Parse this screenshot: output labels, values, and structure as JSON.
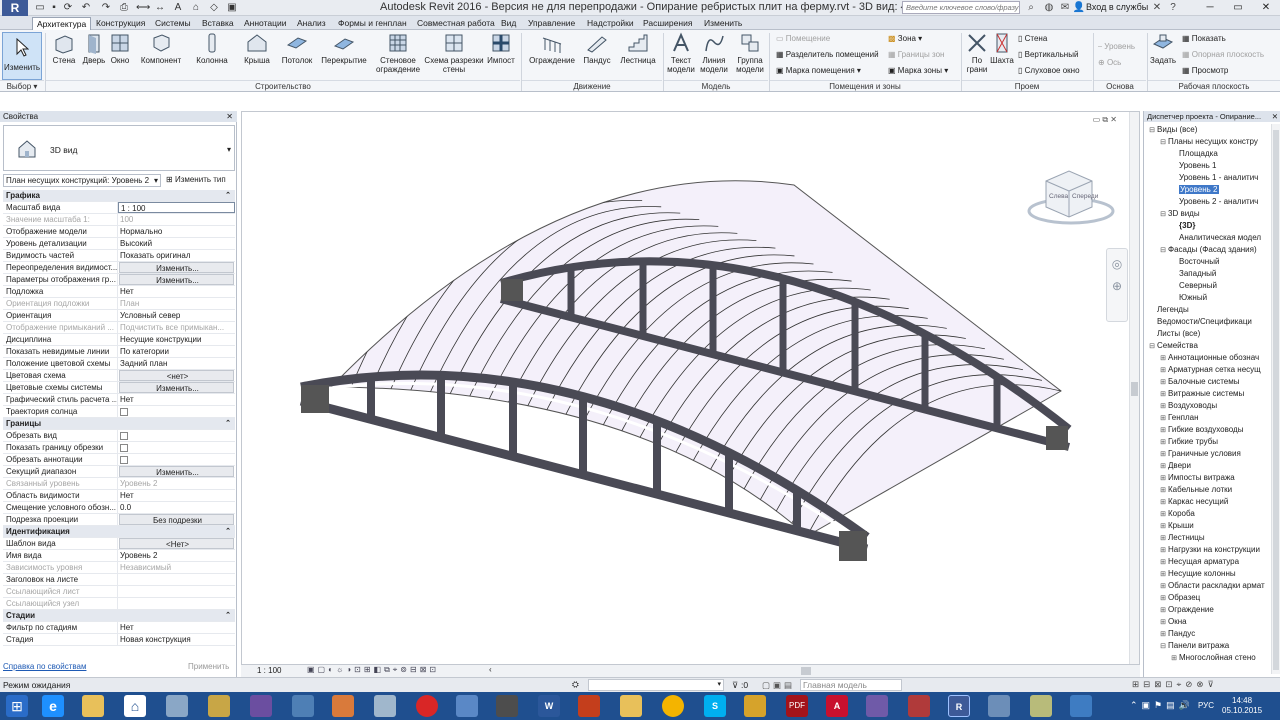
{
  "titlebar": {
    "app_logo": "R",
    "title": "Autodesk Revit 2016 - Версия не для перепродажи -    Опирание ребристых плит на ферму.rvt - 3D вид: {3D}",
    "search_placeholder": "Введите ключевое слово/фразу",
    "signin": "Вход в службы"
  },
  "tabs": [
    "Архитектура",
    "Конструкция",
    "Системы",
    "Вставка",
    "Аннотации",
    "Анализ",
    "Формы и генплан",
    "Совместная работа",
    "Вид",
    "Управление",
    "Надстройки",
    "Расширения",
    "Изменить"
  ],
  "ribbon": {
    "modify": "Изменить",
    "select": "Выбор",
    "build": {
      "label": "Строительство",
      "buttons": [
        "Стена",
        "Дверь",
        "Окно",
        "Компонент",
        "Колонна",
        "Крыша",
        "Потолок",
        "Перекрытие",
        "Стеновое ограждение",
        "Схема разрезки стены",
        "Импост"
      ]
    },
    "circulation": {
      "label": "Движение",
      "buttons": [
        "Ограждение",
        "Пандус",
        "Лестница"
      ]
    },
    "model": {
      "label": "Модель",
      "buttons": [
        "Текст модели",
        "Линия модели",
        "Группа модели"
      ]
    },
    "rooms": {
      "label": "Помещения и зоны",
      "items": [
        "Помещение",
        "Разделитель помещений",
        "Марка помещения",
        "Зона",
        "Границы зон",
        "Марка зоны"
      ]
    },
    "opening": {
      "label": "Проем",
      "buttons": [
        "По грани",
        "Шахта"
      ],
      "items": [
        "Стена",
        "Вертикальный",
        "Слуховое окно"
      ]
    },
    "datum": {
      "label": "Основа",
      "items": [
        "Уровень",
        "Ось"
      ]
    },
    "workplane": {
      "label": "Рабочая плоскость",
      "button": "Задать",
      "items": [
        "Показать",
        "Опорная плоскость",
        "Просмотр"
      ]
    }
  },
  "properties": {
    "title": "Свойства",
    "type_name": "3D вид",
    "view_selector": "План несущих конструкций: Уровень 2",
    "edit_type": "Изменить тип",
    "rows": [
      {
        "hdr": true,
        "k": "Графика"
      },
      {
        "k": "Масштаб вида",
        "v": "1 : 100",
        "input": true
      },
      {
        "k": "Значение масштаба    1:",
        "v": "100",
        "dis": true
      },
      {
        "k": "Отображение модели",
        "v": "Нормально"
      },
      {
        "k": "Уровень детализации",
        "v": "Высокий"
      },
      {
        "k": "Видимость частей",
        "v": "Показать оригинал"
      },
      {
        "k": "Переопределения видимост...",
        "v": "Изменить...",
        "btn": true
      },
      {
        "k": "Параметры отображения гр...",
        "v": "Изменить...",
        "btn": true
      },
      {
        "k": "Подложка",
        "v": "Нет"
      },
      {
        "k": "Ориентация подложки",
        "v": "План",
        "dis": true
      },
      {
        "k": "Ориентация",
        "v": "Условный север"
      },
      {
        "k": "Отображение примыканий ...",
        "v": "Подчистить все примыкан...",
        "dis": true
      },
      {
        "k": "Дисциплина",
        "v": "Несущие конструкции"
      },
      {
        "k": "Показать невидимые линии",
        "v": "По категории"
      },
      {
        "k": "Положение цветовой схемы",
        "v": "Задний план"
      },
      {
        "k": "Цветовая схема",
        "v": "<нет>",
        "btn": true
      },
      {
        "k": "Цветовые схемы системы",
        "v": "Изменить...",
        "btn": true
      },
      {
        "k": "Графический стиль расчета ...",
        "v": "Нет"
      },
      {
        "k": "Траектория солнца",
        "chk": true
      },
      {
        "hdr": true,
        "k": "Границы"
      },
      {
        "k": "Обрезать вид",
        "chk": true
      },
      {
        "k": "Показать границу обрезки",
        "chk": true
      },
      {
        "k": "Обрезать аннотации",
        "chk": true
      },
      {
        "k": "Секущий диапазон",
        "v": "Изменить...",
        "btn": true
      },
      {
        "k": "Связанный уровень",
        "v": "Уровень 2",
        "dis": true
      },
      {
        "k": "Область видимости",
        "v": "Нет"
      },
      {
        "k": "Смещение условного обозн...",
        "v": "0.0"
      },
      {
        "k": "Подрезка проекции",
        "v": "Без подрезки",
        "btn": true
      },
      {
        "hdr": true,
        "k": "Идентификация"
      },
      {
        "k": "Шаблон вида",
        "v": "<Нет>",
        "btn": true
      },
      {
        "k": "Имя вида",
        "v": "Уровень 2"
      },
      {
        "k": "Зависимость уровня",
        "v": "Независимый",
        "dis": true
      },
      {
        "k": "Заголовок на листе",
        "v": ""
      },
      {
        "k": "Ссылающийся лист",
        "v": "",
        "dis": true
      },
      {
        "k": "Ссылающийся узел",
        "v": "",
        "dis": true
      },
      {
        "hdr": true,
        "k": "Стадии"
      },
      {
        "k": "Фильтр по стадиям",
        "v": "Нет"
      },
      {
        "k": "Стадия",
        "v": "Новая конструкция"
      }
    ],
    "help": "Справка по свойствам",
    "apply": "Применить"
  },
  "viewport": {
    "scale": "1 : 100",
    "viewcube": {
      "left": "Слева",
      "front": "Спереди"
    }
  },
  "browser": {
    "title": "Диспетчер проекта - Опирание...",
    "nodes": [
      {
        "d": 0,
        "t": "−",
        "l": "Виды (все)"
      },
      {
        "d": 1,
        "t": "−",
        "l": "Планы несущих констру"
      },
      {
        "d": 2,
        "t": "",
        "l": "Площадка"
      },
      {
        "d": 2,
        "t": "",
        "l": "Уровень 1"
      },
      {
        "d": 2,
        "t": "",
        "l": "Уровень 1 - аналитич"
      },
      {
        "d": 2,
        "t": "",
        "l": "Уровень 2",
        "sel": true
      },
      {
        "d": 2,
        "t": "",
        "l": "Уровень 2 - аналитич"
      },
      {
        "d": 1,
        "t": "−",
        "l": "3D виды"
      },
      {
        "d": 2,
        "t": "",
        "l": "{3D}",
        "b": true
      },
      {
        "d": 2,
        "t": "",
        "l": "Аналитическая модел"
      },
      {
        "d": 1,
        "t": "−",
        "l": "Фасады (Фасад здания)"
      },
      {
        "d": 2,
        "t": "",
        "l": "Восточный"
      },
      {
        "d": 2,
        "t": "",
        "l": "Западный"
      },
      {
        "d": 2,
        "t": "",
        "l": "Северный"
      },
      {
        "d": 2,
        "t": "",
        "l": "Южный"
      },
      {
        "d": 0,
        "t": "",
        "l": "Легенды"
      },
      {
        "d": 0,
        "t": "",
        "l": "Ведомости/Спецификаци"
      },
      {
        "d": 0,
        "t": "",
        "l": "Листы (все)"
      },
      {
        "d": 0,
        "t": "−",
        "l": "Семейства"
      },
      {
        "d": 1,
        "t": "+",
        "l": "Аннотационные обознач"
      },
      {
        "d": 1,
        "t": "+",
        "l": "Арматурная сетка несущ"
      },
      {
        "d": 1,
        "t": "+",
        "l": "Балочные системы"
      },
      {
        "d": 1,
        "t": "+",
        "l": "Витражные системы"
      },
      {
        "d": 1,
        "t": "+",
        "l": "Воздуховоды"
      },
      {
        "d": 1,
        "t": "+",
        "l": "Генплан"
      },
      {
        "d": 1,
        "t": "+",
        "l": "Гибкие воздуховоды"
      },
      {
        "d": 1,
        "t": "+",
        "l": "Гибкие трубы"
      },
      {
        "d": 1,
        "t": "+",
        "l": "Граничные условия"
      },
      {
        "d": 1,
        "t": "+",
        "l": "Двери"
      },
      {
        "d": 1,
        "t": "+",
        "l": "Импосты витража"
      },
      {
        "d": 1,
        "t": "+",
        "l": "Кабельные лотки"
      },
      {
        "d": 1,
        "t": "+",
        "l": "Каркас несущий"
      },
      {
        "d": 1,
        "t": "+",
        "l": "Короба"
      },
      {
        "d": 1,
        "t": "+",
        "l": "Крыши"
      },
      {
        "d": 1,
        "t": "+",
        "l": "Лестницы"
      },
      {
        "d": 1,
        "t": "+",
        "l": "Нагрузки на конструкции"
      },
      {
        "d": 1,
        "t": "+",
        "l": "Несущая арматура"
      },
      {
        "d": 1,
        "t": "+",
        "l": "Несущие колонны"
      },
      {
        "d": 1,
        "t": "+",
        "l": "Области раскладки армат"
      },
      {
        "d": 1,
        "t": "+",
        "l": "Образец"
      },
      {
        "d": 1,
        "t": "+",
        "l": "Ограждение"
      },
      {
        "d": 1,
        "t": "+",
        "l": "Окна"
      },
      {
        "d": 1,
        "t": "+",
        "l": "Пандус"
      },
      {
        "d": 1,
        "t": "−",
        "l": "Панели витража"
      },
      {
        "d": 2,
        "t": "+",
        "l": "Многослойная стено"
      }
    ]
  },
  "status": {
    "text": "Режим ожидания",
    "zero": ":0",
    "model": "Главная модель"
  },
  "taskbar": {
    "lang": "РУС",
    "time": "14:48",
    "date": "05.10.2015"
  }
}
